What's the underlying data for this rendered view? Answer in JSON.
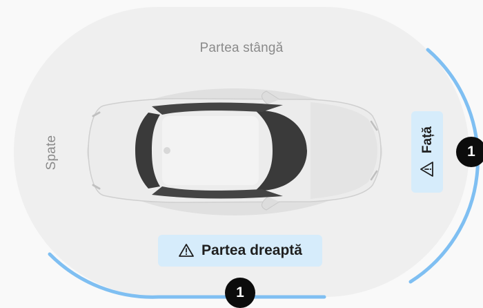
{
  "sides": {
    "left": {
      "label": "Partea stângă"
    },
    "rear": {
      "label": "Spate"
    },
    "right": {
      "label": "Partea dreaptă",
      "alert_count": "1",
      "icon": "warning-triangle-icon"
    },
    "front": {
      "label": "Față",
      "alert_count": "1",
      "icon": "warning-triangle-icon"
    }
  },
  "colors": {
    "zone_background": "#efefef",
    "alert_arc": "#7fbff2",
    "badge_background": "#d6ecfb",
    "count_background": "#0c0c0c"
  },
  "vehicle": {
    "icon": "car-top-view-icon"
  }
}
